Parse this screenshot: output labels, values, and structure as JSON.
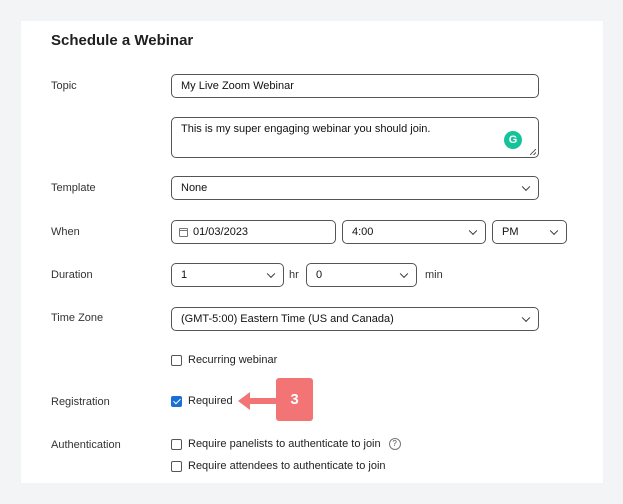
{
  "page": {
    "title": "Schedule a Webinar"
  },
  "topic": {
    "label": "Topic",
    "value": "My Live Zoom Webinar",
    "description": "This is my super engaging webinar you should join."
  },
  "template": {
    "label": "Template",
    "value": "None"
  },
  "when": {
    "label": "When",
    "date": "01/03/2023",
    "time": "4:00",
    "ampm": "PM"
  },
  "duration": {
    "label": "Duration",
    "hours": "1",
    "hours_unit": "hr",
    "minutes": "0",
    "minutes_unit": "min"
  },
  "timezone": {
    "label": "Time Zone",
    "value": "(GMT-5:00) Eastern Time (US and Canada)"
  },
  "recurring": {
    "label": "Recurring webinar",
    "checked": false
  },
  "registration": {
    "label": "Registration",
    "option_label": "Required",
    "checked": true
  },
  "authentication": {
    "label": "Authentication",
    "panelists_label": "Require panelists to authenticate to join",
    "attendees_label": "Require attendees to authenticate to join",
    "help_glyph": "?"
  },
  "annotation": {
    "step_number": "3",
    "color": "#f27474"
  },
  "icons": {
    "grammarly": "grammarly-icon",
    "calendar": "calendar-icon",
    "chevron": "chevron-down-icon",
    "help": "help-icon",
    "arrow": "arrow-left-icon"
  }
}
